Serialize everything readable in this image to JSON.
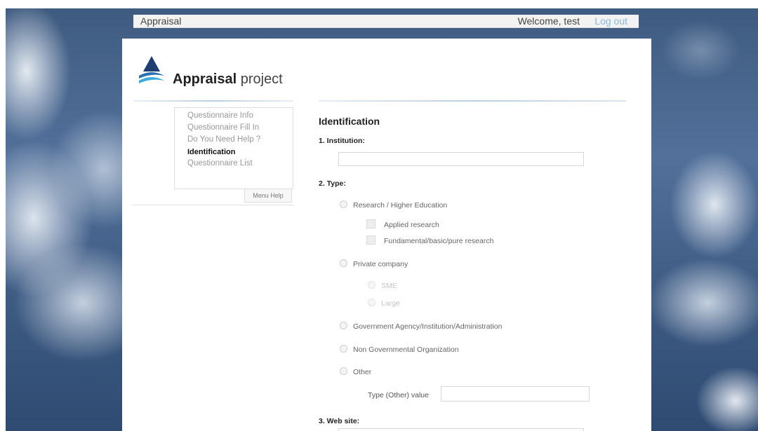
{
  "topbar": {
    "app_title": "Appraisal",
    "welcome": "Welcome, test",
    "logout": "Log out"
  },
  "brand": {
    "name_bold": "Appraisal",
    "name_light": " project"
  },
  "sidebar": {
    "items": [
      {
        "label": "Questionnaire Info",
        "active": false
      },
      {
        "label": "Questionnaire Fill In",
        "active": false
      },
      {
        "label": "Do You Need Help ?",
        "active": false
      },
      {
        "label": "Identification",
        "active": true
      },
      {
        "label": "Questionnaire List",
        "active": false
      }
    ],
    "menu_help": "Menu Help"
  },
  "form": {
    "section_title": "Identification",
    "q1": {
      "label": "1. Institution:",
      "value": ""
    },
    "q2": {
      "label": "2. Type:",
      "options": {
        "research": "Research / Higher Education",
        "applied": "Applied research",
        "fundamental": "Fundamental/basic/pure research",
        "private": "Private company",
        "sme": "SME",
        "large": "Large",
        "government": "Government Agency/Institution/Administration",
        "ngo": "Non Governmental Organization",
        "other": "Other"
      },
      "other_value_label": "Type (Other) value",
      "other_value": ""
    },
    "q3": {
      "label": "3. Web site:"
    }
  },
  "colors": {
    "link": "#8ab8da",
    "accent_line": "#b9cfe2",
    "logo_dark": "#1f3f73",
    "logo_light": "#3fa9dc"
  }
}
